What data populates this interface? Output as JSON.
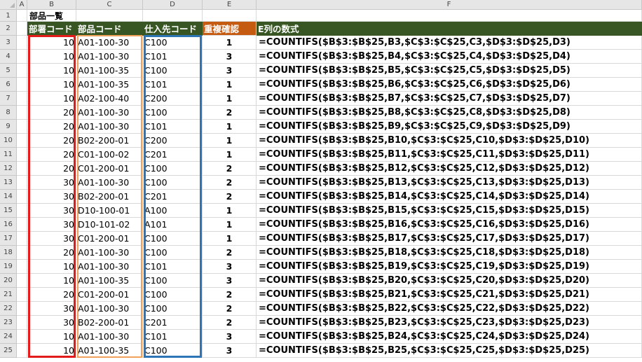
{
  "columns": [
    "A",
    "B",
    "C",
    "D",
    "E",
    "F"
  ],
  "rows": [
    1,
    2,
    3,
    4,
    5,
    6,
    7,
    8,
    9,
    10,
    11,
    12,
    13,
    14,
    15,
    16,
    17,
    18,
    19,
    20,
    21,
    22,
    23,
    24,
    25
  ],
  "title": "部品一覧",
  "headers": {
    "b": "部署コード",
    "c": "部品コード",
    "d": "仕入先コード",
    "e": "重複確認",
    "f": "E列の数式"
  },
  "data": [
    {
      "b": "10",
      "c": "A01-100-30",
      "d": "C100",
      "e": "1",
      "f": "=COUNTIFS($B$3:$B$25,B3,$C$3:$C$25,C3,$D$3:$D$25,D3)"
    },
    {
      "b": "10",
      "c": "A01-100-30",
      "d": "C101",
      "e": "3",
      "f": "=COUNTIFS($B$3:$B$25,B4,$C$3:$C$25,C4,$D$3:$D$25,D4)"
    },
    {
      "b": "10",
      "c": "A01-100-35",
      "d": "C100",
      "e": "3",
      "f": "=COUNTIFS($B$3:$B$25,B5,$C$3:$C$25,C5,$D$3:$D$25,D5)"
    },
    {
      "b": "10",
      "c": "A01-100-35",
      "d": "C101",
      "e": "1",
      "f": "=COUNTIFS($B$3:$B$25,B6,$C$3:$C$25,C6,$D$3:$D$25,D6)"
    },
    {
      "b": "10",
      "c": "A02-100-40",
      "d": "C200",
      "e": "1",
      "f": "=COUNTIFS($B$3:$B$25,B7,$C$3:$C$25,C7,$D$3:$D$25,D7)"
    },
    {
      "b": "20",
      "c": "A01-100-30",
      "d": "C100",
      "e": "2",
      "f": "=COUNTIFS($B$3:$B$25,B8,$C$3:$C$25,C8,$D$3:$D$25,D8)"
    },
    {
      "b": "20",
      "c": "A01-100-30",
      "d": "C101",
      "e": "1",
      "f": "=COUNTIFS($B$3:$B$25,B9,$C$3:$C$25,C9,$D$3:$D$25,D9)"
    },
    {
      "b": "20",
      "c": "B02-200-01",
      "d": "C200",
      "e": "1",
      "f": "=COUNTIFS($B$3:$B$25,B10,$C$3:$C$25,C10,$D$3:$D$25,D10)"
    },
    {
      "b": "20",
      "c": "C01-100-02",
      "d": "C201",
      "e": "1",
      "f": "=COUNTIFS($B$3:$B$25,B11,$C$3:$C$25,C11,$D$3:$D$25,D11)"
    },
    {
      "b": "20",
      "c": "C01-200-01",
      "d": "C100",
      "e": "2",
      "f": "=COUNTIFS($B$3:$B$25,B12,$C$3:$C$25,C12,$D$3:$D$25,D12)"
    },
    {
      "b": "30",
      "c": "A01-100-30",
      "d": "C100",
      "e": "2",
      "f": "=COUNTIFS($B$3:$B$25,B13,$C$3:$C$25,C13,$D$3:$D$25,D13)"
    },
    {
      "b": "30",
      "c": "B02-200-01",
      "d": "C201",
      "e": "2",
      "f": "=COUNTIFS($B$3:$B$25,B14,$C$3:$C$25,C14,$D$3:$D$25,D14)"
    },
    {
      "b": "30",
      "c": "D10-100-01",
      "d": "A100",
      "e": "1",
      "f": "=COUNTIFS($B$3:$B$25,B15,$C$3:$C$25,C15,$D$3:$D$25,D15)"
    },
    {
      "b": "30",
      "c": "D10-101-02",
      "d": "A101",
      "e": "1",
      "f": "=COUNTIFS($B$3:$B$25,B16,$C$3:$C$25,C16,$D$3:$D$25,D16)"
    },
    {
      "b": "30",
      "c": "C01-200-01",
      "d": "C100",
      "e": "1",
      "f": "=COUNTIFS($B$3:$B$25,B17,$C$3:$C$25,C17,$D$3:$D$25,D17)"
    },
    {
      "b": "20",
      "c": "A01-100-30",
      "d": "C100",
      "e": "2",
      "f": "=COUNTIFS($B$3:$B$25,B18,$C$3:$C$25,C18,$D$3:$D$25,D18)"
    },
    {
      "b": "10",
      "c": "A01-100-30",
      "d": "C101",
      "e": "3",
      "f": "=COUNTIFS($B$3:$B$25,B19,$C$3:$C$25,C19,$D$3:$D$25,D19)"
    },
    {
      "b": "10",
      "c": "A01-100-35",
      "d": "C100",
      "e": "3",
      "f": "=COUNTIFS($B$3:$B$25,B20,$C$3:$C$25,C20,$D$3:$D$25,D20)"
    },
    {
      "b": "20",
      "c": "C01-200-01",
      "d": "C100",
      "e": "2",
      "f": "=COUNTIFS($B$3:$B$25,B21,$C$3:$C$25,C21,$D$3:$D$25,D21)"
    },
    {
      "b": "30",
      "c": "A01-100-30",
      "d": "C100",
      "e": "2",
      "f": "=COUNTIFS($B$3:$B$25,B22,$C$3:$C$25,C22,$D$3:$D$25,D22)"
    },
    {
      "b": "30",
      "c": "B02-200-01",
      "d": "C201",
      "e": "2",
      "f": "=COUNTIFS($B$3:$B$25,B23,$C$3:$C$25,C23,$D$3:$D$25,D23)"
    },
    {
      "b": "10",
      "c": "A01-100-30",
      "d": "C101",
      "e": "3",
      "f": "=COUNTIFS($B$3:$B$25,B24,$C$3:$C$25,C24,$D$3:$D$25,D24)"
    },
    {
      "b": "10",
      "c": "A01-100-35",
      "d": "C100",
      "e": "3",
      "f": "=COUNTIFS($B$3:$B$25,B25,$C$3:$C$25,C25,$D$3:$D$25,D25)"
    }
  ],
  "colors": {
    "header_green": "#375623",
    "header_orange": "#c55a11",
    "box_red": "#e31b1b",
    "box_orange": "#f0a15b",
    "box_blue": "#2e75b6"
  }
}
